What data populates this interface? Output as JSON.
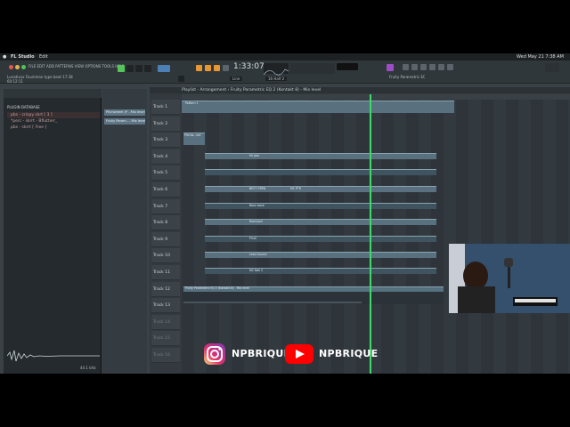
{
  "menubar": {
    "app_name": "FL Studio",
    "edit_menu": "Edit",
    "clock": "Wed May 21  7:38 AM"
  },
  "toolbar": {
    "main_menu": "FILE  EDIT  ADD  PATTERNS  VIEW  OPTIONS  TOOLS  HELP",
    "time_display": "1:33:07",
    "pattern_mode": "Line",
    "snap_value": "16 Half 2",
    "song_info": "Lunatixxx  Fouinman type beat 17:38",
    "bpm": "60:12:11",
    "hint_title": "Fruity Parametric EQ 2 (Kontakt 8) - Mix level"
  },
  "browser": {
    "header": "PLUGIN DATABASE",
    "items": [
      {
        "label": "pbs - crispy skrt [ 3 ]"
      },
      {
        "label": "*perc - skrrt - Bflutterr_"
      },
      {
        "label": "pbs - skrrt [ Free ]"
      }
    ],
    "waveform_label": "44.1 kHz"
  },
  "picker": {
    "items": [
      {
        "label": "Pitchwheel (P - Mix level"
      },
      {
        "label": "Fruity Param.. - Mix level"
      }
    ]
  },
  "playlist": {
    "title": "Playlist - Arrangement › Fruity Parametric EQ 2 (Kontakt 8) - Mix level",
    "tracks": [
      {
        "label": "Track 1"
      },
      {
        "label": "Track 2"
      },
      {
        "label": "Track 3"
      },
      {
        "label": "Track 4"
      },
      {
        "label": "Track 5"
      },
      {
        "label": "Track 6"
      },
      {
        "label": "Track 7"
      },
      {
        "label": "Track 8"
      },
      {
        "label": "Track 9"
      },
      {
        "label": "Track 10"
      },
      {
        "label": "Track 11"
      },
      {
        "label": "Track 12"
      },
      {
        "label": "Track 13"
      },
      {
        "label": "Track 14"
      },
      {
        "label": "Track 15"
      },
      {
        "label": "Track 16"
      }
    ],
    "automation_clip": "Fruity Parametric EQ 2 (Kontakt 8) - Mix level",
    "clip_names": {
      "t1": "Pattern 1",
      "t3": "Pitchw...red",
      "t4": "Mr Jam",
      "t6": "BEST OPEN",
      "t6b": "MC PTR",
      "t7": "Bass wave",
      "t8": "Ramshell",
      "t9": "Pindl",
      "t10": "Lead Source",
      "t11": "MC Nail 2"
    }
  },
  "social": {
    "instagram": "NPBRIQUE",
    "youtube": "NPBRIQUE",
    "instagram_color": "#e1306c",
    "youtube_color": "#ff0000"
  }
}
